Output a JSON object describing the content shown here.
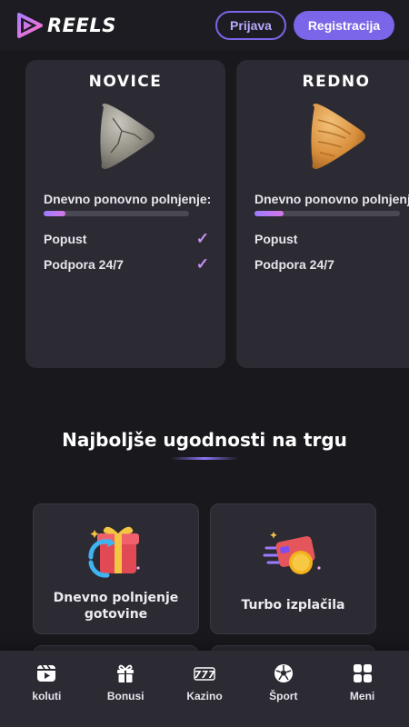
{
  "header": {
    "logo_text": "REELS",
    "login_label": "Prijava",
    "register_label": "Registracija"
  },
  "levels": [
    {
      "name": "NOVICE",
      "icon": "stone-triangle-icon",
      "reload_label": "Dnevno ponovno polnjenje:",
      "progress": 0.15,
      "perks": [
        {
          "label": "Popust",
          "included": true
        },
        {
          "label": "Podpora 24/7",
          "included": true
        }
      ]
    },
    {
      "name": "REDNO",
      "icon": "wood-triangle-icon",
      "reload_label": "Dnevno ponovno polnjenje:",
      "progress": 0.2,
      "perks": [
        {
          "label": "Popust",
          "included": true
        },
        {
          "label": "Podpora 24/7",
          "included": true
        }
      ]
    }
  ],
  "section": {
    "title": "Najboljše ugodnosti na trgu"
  },
  "features": [
    {
      "title": "Dnevno polnjenje gotovine",
      "icon": "gift-refresh-icon"
    },
    {
      "title": "Turbo izplačila",
      "icon": "flying-coin-card-icon"
    }
  ],
  "bottom_nav": [
    {
      "label": "koluti",
      "icon": "reels-video-icon"
    },
    {
      "label": "Bonusi",
      "icon": "gift-icon"
    },
    {
      "label": "Kazino",
      "icon": "slot-777-icon"
    },
    {
      "label": "Šport",
      "icon": "soccer-ball-icon"
    },
    {
      "label": "Meni",
      "icon": "grid-menu-icon"
    }
  ],
  "colors": {
    "accent": "#7b65e8",
    "background": "#19181d",
    "card": "#2c2b34",
    "check": "#c48ff0"
  }
}
